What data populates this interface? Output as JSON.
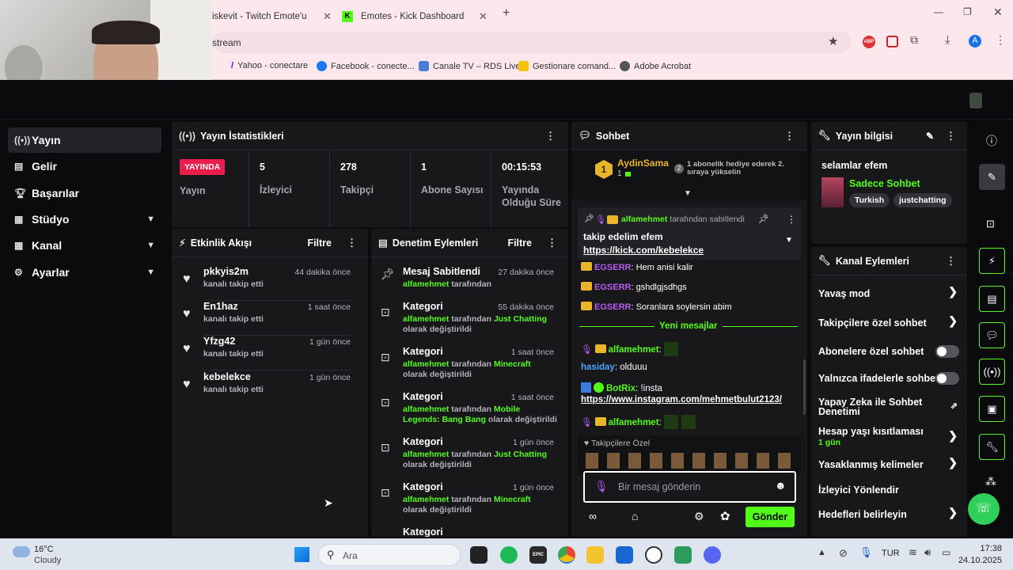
{
  "browser": {
    "tabs": [
      {
        "label": "iskevit - Twitch Emote'u"
      },
      {
        "label": "Emotes - Kick Dashboard"
      }
    ],
    "url": "stream",
    "bookmarks": [
      "Yahoo - conectare",
      "Facebook - conecte...",
      "Canale TV – RDS Live",
      "Gestionare comand...",
      "Adobe Acrobat"
    ],
    "ext_abp": "ABP",
    "profile_initial": "A"
  },
  "nav": {
    "items": [
      {
        "label": "Yayın"
      },
      {
        "label": "Gelir"
      },
      {
        "label": "Başarılar"
      },
      {
        "label": "Stüdyo"
      },
      {
        "label": "Kanal"
      },
      {
        "label": "Ayarlar"
      }
    ]
  },
  "stats": {
    "title": "Yayın İstatistikleri",
    "live_badge": "YAYINDA",
    "live_label": "Yayın",
    "items": [
      {
        "value": "5",
        "label": "İzleyici"
      },
      {
        "value": "278",
        "label": "Takipçi"
      },
      {
        "value": "1",
        "label": "Abone Sayısı"
      },
      {
        "value": "00:15:53",
        "label": "Yayında Olduğu Süre"
      }
    ]
  },
  "activity": {
    "title": "Etkinlik Akışı",
    "filter": "Filtre",
    "events": [
      {
        "name": "pkkyis2m",
        "sub": "kanalı takip etti",
        "time": "44 dakika önce"
      },
      {
        "name": "En1haz",
        "sub": "kanalı takip etti",
        "time": "1 saat önce"
      },
      {
        "name": "Yfzg42",
        "sub": "kanalı takip etti",
        "time": "1 gün önce"
      },
      {
        "name": "kebelekce",
        "sub": "kanalı takip etti",
        "time": "1 gün önce"
      }
    ]
  },
  "mod": {
    "title": "Denetim Eylemleri",
    "filter": "Filtre",
    "items": [
      {
        "title": "Mesaj Sabitlendi",
        "time": "27 dakika önce",
        "user": "alfamehmet",
        "mid": " tarafından",
        "cat": "",
        "tail": ""
      },
      {
        "title": "Kategori",
        "time": "55 dakika önce",
        "user": "alfamehmet",
        "mid": " tarafından ",
        "cat": "Just Chatting",
        "tail": " olarak değiştirildi"
      },
      {
        "title": "Kategori",
        "time": "1 saat önce",
        "user": "alfamehmet",
        "mid": " tarafından ",
        "cat": "Minecraft",
        "tail": " olarak değiştirildi"
      },
      {
        "title": "Kategori",
        "time": "1 saat önce",
        "user": "alfamehmet",
        "mid": " tarafından ",
        "cat": "Mobile Legends: Bang Bang",
        "tail": " olarak değiştirildi"
      },
      {
        "title": "Kategori",
        "time": "1 gün önce",
        "user": "alfamehmet",
        "mid": " tarafından ",
        "cat": "Just Chatting",
        "tail": " olarak değiştirildi"
      },
      {
        "title": "Kategori",
        "time": "1 gün önce",
        "user": "alfamehmet",
        "mid": " tarafından ",
        "cat": "Minecraft",
        "tail": " olarak değiştirildi"
      }
    ],
    "partial": "Kategori"
  },
  "chat": {
    "title": "Sohbet",
    "top_user": "AydinSama",
    "top_rank": "1",
    "top_count": "1",
    "gift_num": "2",
    "gift_text": "1 abonelik hediye ederek 2. sıraya yükselin",
    "pinned_by": "alfamehmet",
    "pinned_by_suffix": " tarafından sabitlendi",
    "pinned_msg": "takip edelim efem",
    "pinned_link": "https://kick.com/kebelekce",
    "messages": [
      {
        "user": "EGSERR",
        "text": ": Hem anisi kalir"
      },
      {
        "user": "EGSERR",
        "text": ": gshdlgjsdhgs"
      },
      {
        "user": "EGSERR",
        "text": ": Soranlara soylersin abim"
      }
    ],
    "new_messages": "Yeni mesajlar",
    "msg_alfa": "alfamehmet",
    "hasiday_user": "hasiday",
    "hasiday_text": ": olduuu",
    "botrix_user": "BotRix",
    "botrix_text": ": !insta",
    "botrix_link": "https://www.instagram.com/mehmetbulut2123/",
    "emote_section": "Takipçilere Özel",
    "input_placeholder": "Bir mesaj gönderin",
    "send": "Gönder"
  },
  "info": {
    "title": "Yayın bilgisi",
    "stream_title": "selamlar efem",
    "category": "Sadece Sohbet",
    "tags": [
      "Turkish",
      "justchatting"
    ]
  },
  "channel_actions": {
    "title": "Kanal Eylemleri",
    "items": [
      {
        "label": "Yavaş mod",
        "control": "chevron"
      },
      {
        "label": "Takipçilere özel sohbet",
        "control": "chevron"
      },
      {
        "label": "Abonelere özel sohbet",
        "control": "toggle"
      },
      {
        "label": "Yalnızca ifadelerle sohbet",
        "control": "toggle"
      },
      {
        "label": "Yapay Zeka ile Sohbet Denetimi",
        "control": "external"
      },
      {
        "label": "Hesap yaşı kısıtlaması",
        "control": "chevron",
        "sub": "1 gün"
      },
      {
        "label": "Yasaklanmış kelimeler",
        "control": "chevron"
      },
      {
        "label": "İzleyici Yönlendir",
        "control": "none"
      },
      {
        "label": "Hedefleri belirleyin",
        "control": "chevron"
      }
    ]
  },
  "taskbar": {
    "weather_temp": "16°C",
    "weather_desc": "Cloudy",
    "search": "Ara",
    "lang": "TUR",
    "time": "17:38",
    "date": "24.10.2025",
    "epic": "EPIC"
  },
  "colors": {
    "accent": "#53fc18",
    "live": "#e91e4c",
    "panel": "#18181b"
  }
}
